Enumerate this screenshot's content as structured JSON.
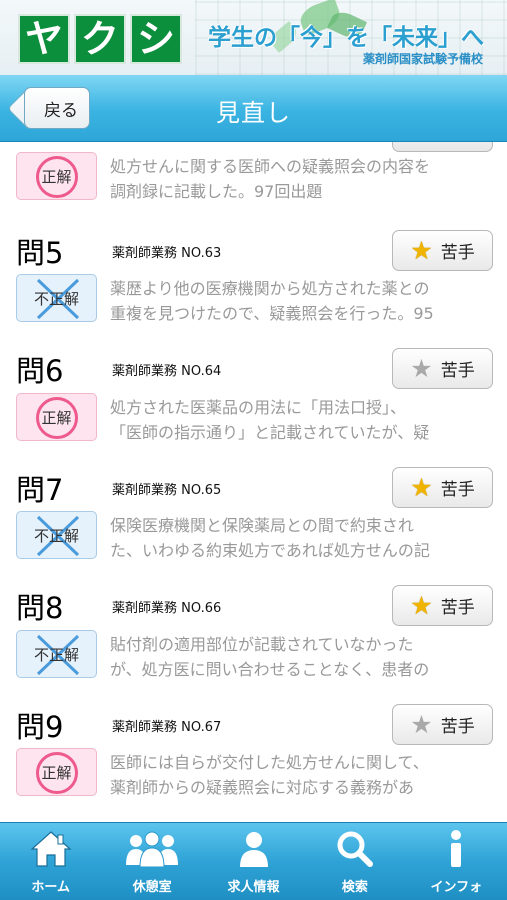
{
  "banner": {
    "logo_chars": [
      "ヤ",
      "ク",
      "シ"
    ],
    "slogan": "学生の「今」を「未来」へ",
    "school": "薬剤師国家試験予備校",
    "brand_color": "#0b8f3c",
    "slogan_color": "#2a9fd0"
  },
  "nav": {
    "back_label": "戻る",
    "title": "見直し"
  },
  "badges": {
    "correct": "正解",
    "wrong": "不正解"
  },
  "fav_label": "苦手",
  "partial_item": {
    "result": "correct",
    "text_lines": [
      "処方せんに関する医師への疑義照会の内容を",
      "調剤録に記載した。97回出題"
    ]
  },
  "questions": [
    {
      "number": "問5",
      "category": "薬剤師業務 NO.63",
      "favorite": true,
      "result": "wrong",
      "text_lines": [
        "薬歴より他の医療機関から処方された薬との",
        "重複を見つけたので、疑義照会を行った。95"
      ]
    },
    {
      "number": "問6",
      "category": "薬剤師業務 NO.64",
      "favorite": false,
      "result": "correct",
      "text_lines": [
        "処方された医薬品の用法に「用法口授」、",
        "「医師の指示通り」と記載されていたが、疑"
      ]
    },
    {
      "number": "問7",
      "category": "薬剤師業務 NO.65",
      "favorite": true,
      "result": "wrong",
      "text_lines": [
        "保険医療機関と保険薬局との間で約束され",
        "た、いわゆる約束処方であれば処方せんの記"
      ]
    },
    {
      "number": "問8",
      "category": "薬剤師業務 NO.66",
      "favorite": true,
      "result": "wrong",
      "text_lines": [
        "貼付剤の適用部位が記載されていなかった",
        "が、処方医に問い合わせることなく、患者の"
      ]
    },
    {
      "number": "問9",
      "category": "薬剤師業務 NO.67",
      "favorite": false,
      "result": "correct",
      "text_lines": [
        "医師には自らが交付した処方せんに関して、",
        "薬剤師からの疑義照会に対応する義務があ"
      ]
    }
  ],
  "tabs": [
    {
      "label": "ホーム",
      "icon": "home-icon"
    },
    {
      "label": "休憩室",
      "icon": "people-icon"
    },
    {
      "label": "求人情報",
      "icon": "person-icon"
    },
    {
      "label": "検索",
      "icon": "search-icon"
    },
    {
      "label": "インフォ",
      "icon": "info-icon"
    }
  ]
}
